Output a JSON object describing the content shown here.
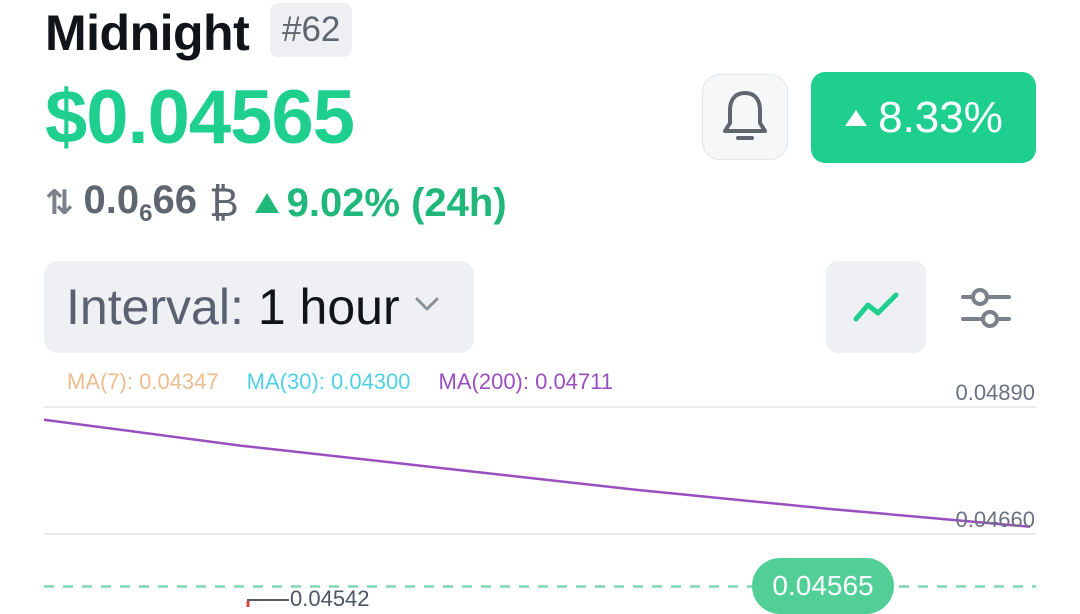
{
  "coin": {
    "name": "Midnight",
    "rank": "#62",
    "price": "$0.04565",
    "btc_price_main": "0.0",
    "btc_price_sub": "6",
    "btc_price_tail": "66",
    "btc_symbol": "₿",
    "change_24h": "9.02% (24h)",
    "change_badge": "8.33%"
  },
  "icons": {
    "swap": "swap-vertical-icon",
    "bell": "bell-icon",
    "up": "triangle-up-icon",
    "chevron": "chevron-down-icon",
    "line_chart": "line-chart-icon",
    "settings": "sliders-icon"
  },
  "controls": {
    "interval_label": "Interval:",
    "interval_value": "1 hour"
  },
  "chart_data": {
    "type": "line",
    "legend": [
      {
        "name": "MA(7)",
        "value": "0.04347",
        "color": "#eebd8f"
      },
      {
        "name": "MA(30)",
        "value": "0.04300",
        "color": "#4fd1e3"
      },
      {
        "name": "MA(200)",
        "value": "0.04711",
        "color": "#9a4fc0"
      }
    ],
    "legend_text": [
      "MA(7): 0.04347",
      "MA(30): 0.04300",
      "MA(200): 0.04711"
    ],
    "y_ticks": [
      "0.04890",
      "0.04660"
    ],
    "ylim": [
      0.0456,
      0.0489
    ],
    "series": [
      {
        "name": "MA(200)",
        "color": "#9a4fc0",
        "values": [
          0.04867,
          0.0482,
          0.0478,
          0.0474,
          0.04705,
          0.04673
        ]
      }
    ],
    "current_price_line": 0.04565,
    "current_price_label": "0.04565",
    "low_label": "0.04542"
  },
  "colors": {
    "accent": "#1fcf90",
    "up": "#1fb87a",
    "grid": "#e8eaee",
    "dashed": "#7fd8b4"
  }
}
